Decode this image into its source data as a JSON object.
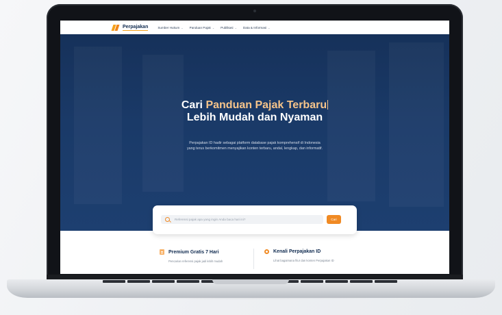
{
  "nav": {
    "logo": "Perpajakan",
    "items": [
      {
        "label": "Sumber Hukum"
      },
      {
        "label": "Panduan Pajak"
      },
      {
        "label": "Publikasi"
      },
      {
        "label": "Data & Informasi"
      }
    ],
    "chevron": "⌄"
  },
  "hero": {
    "title_prefix": "Cari ",
    "title_highlight": "Panduan Pajak Terbaru",
    "title_line2": "Lebih Mudah dan Nyaman",
    "subtitle_line1": "Perpajakan ID hadir sebagai platform database pajak komprehensif di Indonesia",
    "subtitle_line2": "yang terus berkomitmen menyajikan konten terbaru, andal, lengkap, dan informatif."
  },
  "search": {
    "placeholder": "Referensi pajak apa yang ingin Anda baca hari ini?",
    "button_label": "Cari"
  },
  "cards": [
    {
      "title": "Premium Gratis 7 Hari",
      "desc": "Pencarian referensi pajak jadi lebih mudah",
      "icon": "document-icon"
    },
    {
      "title": "Kenali Perpajakan ID",
      "desc": "Lihat bagaimana fitur dan konten Perpajakan ID",
      "icon": "location-pin-icon"
    }
  ],
  "colors": {
    "accent": "#f08a24",
    "navy": "#0f2a4f",
    "hero": "#1a3a68",
    "highlight": "#f6c48a"
  }
}
